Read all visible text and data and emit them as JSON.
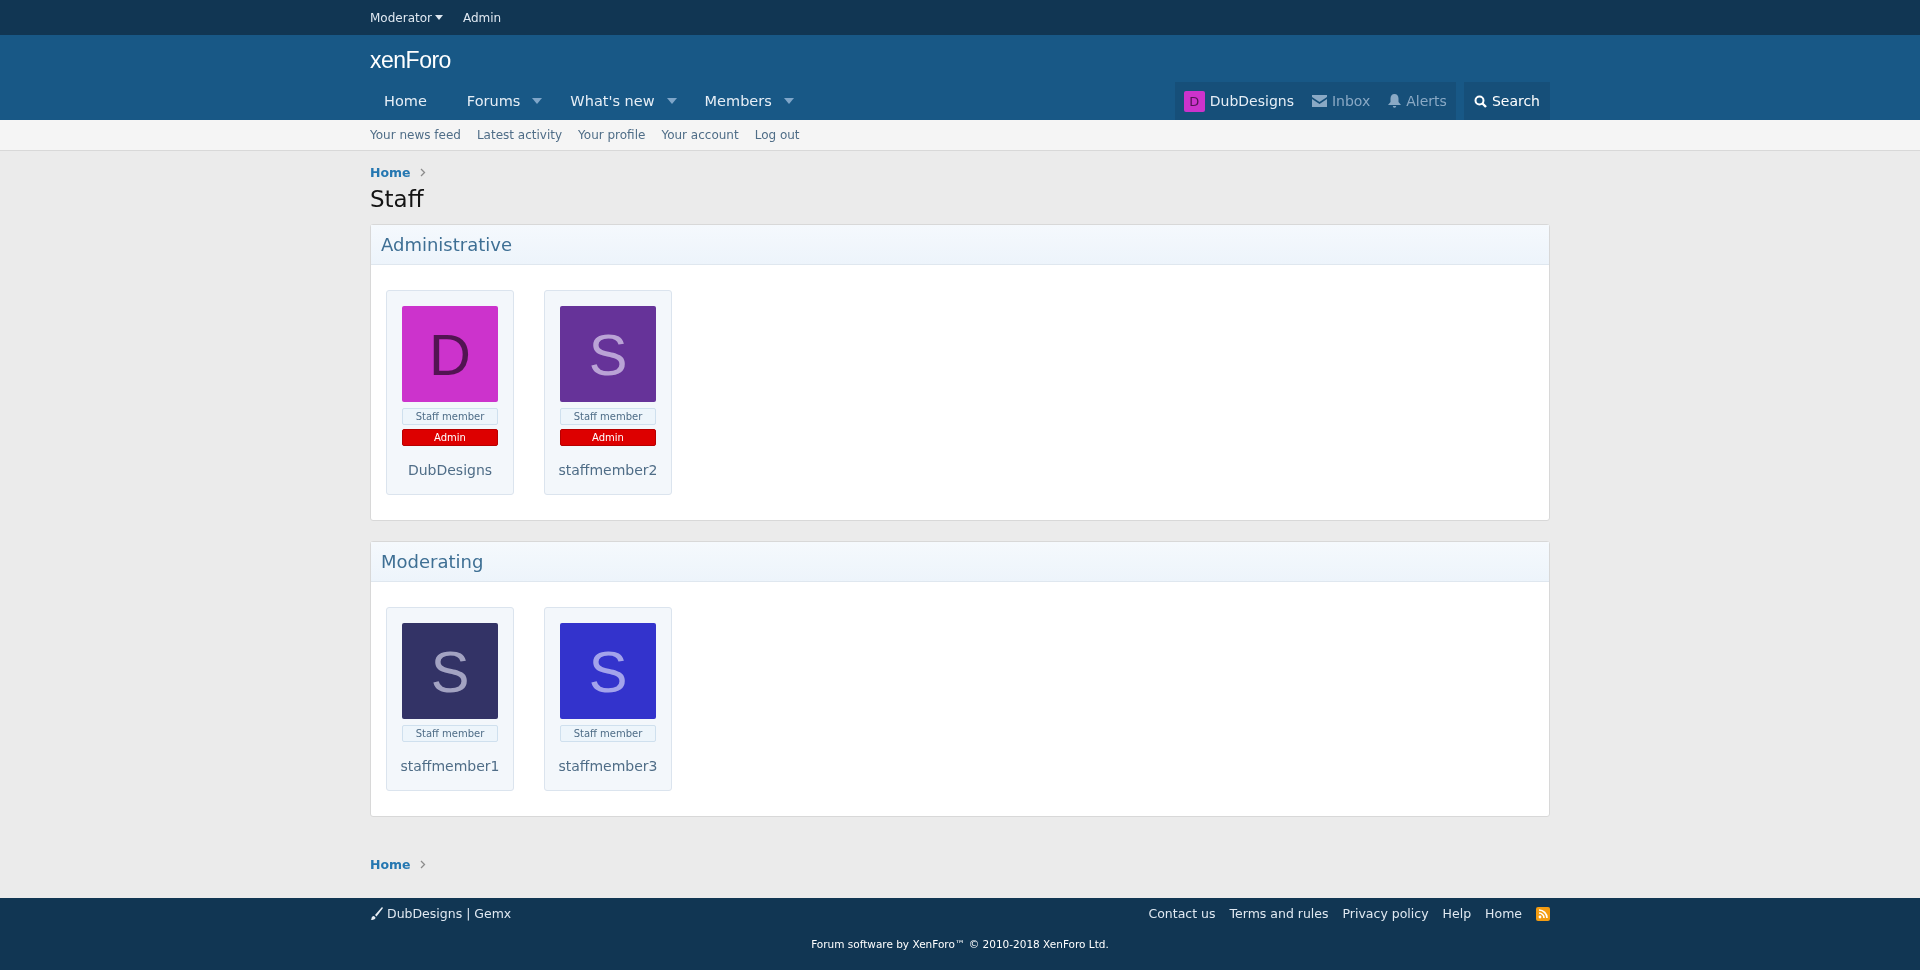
{
  "top_bar": {
    "items": [
      {
        "label": "Moderator",
        "has_menu": true
      },
      {
        "label": "Admin",
        "has_menu": false
      }
    ]
  },
  "header": {
    "logo": "xen**Foro**"
  },
  "nav": {
    "items": [
      {
        "label": "Home",
        "has_menu": false
      },
      {
        "label": "Forums",
        "has_menu": true
      },
      {
        "label": "What's new",
        "has_menu": true
      },
      {
        "label": "Members",
        "has_menu": true
      }
    ],
    "account": {
      "letter": "D",
      "color": "#cc33cc",
      "name": "DubDesigns"
    },
    "inbox": "Inbox",
    "alerts": "Alerts",
    "search": "Search"
  },
  "sub_nav": {
    "items": [
      "Your news feed",
      "Latest activity",
      "Your profile",
      "Your account",
      "Log out"
    ]
  },
  "breadcrumb": "Home",
  "page_title": "Staff",
  "groups": [
    {
      "title": "Administrative",
      "members": [
        {
          "letter": "D",
          "color": "#cc33cc",
          "name": "DubDesigns",
          "banners": [
            {
              "text": "Staff member",
              "kind": "staff"
            },
            {
              "text": "Admin",
              "kind": "admin"
            }
          ]
        },
        {
          "letter": "S",
          "color": "#663399",
          "name": "staffmember2",
          "banners": [
            {
              "text": "Staff member",
              "kind": "staff"
            },
            {
              "text": "Admin",
              "kind": "admin"
            }
          ]
        }
      ]
    },
    {
      "title": "Moderating",
      "members": [
        {
          "letter": "S",
          "color": "#333366",
          "name": "staffmember1",
          "banners": [
            {
              "text": "Staff member",
              "kind": "staff"
            }
          ]
        },
        {
          "letter": "S",
          "color": "#3333cc",
          "name": "staffmember3",
          "banners": [
            {
              "text": "Staff member",
              "kind": "staff"
            }
          ]
        }
      ]
    }
  ],
  "bottom_breadcrumb": "Home",
  "footer": {
    "style_credit": "DubDesigns | Gemx",
    "links": [
      "Contact us",
      "Terms and rules",
      "Privacy policy",
      "Help",
      "Home"
    ],
    "copyright": "Forum software by XenForo™ © 2010-2018 XenForo Ltd."
  }
}
